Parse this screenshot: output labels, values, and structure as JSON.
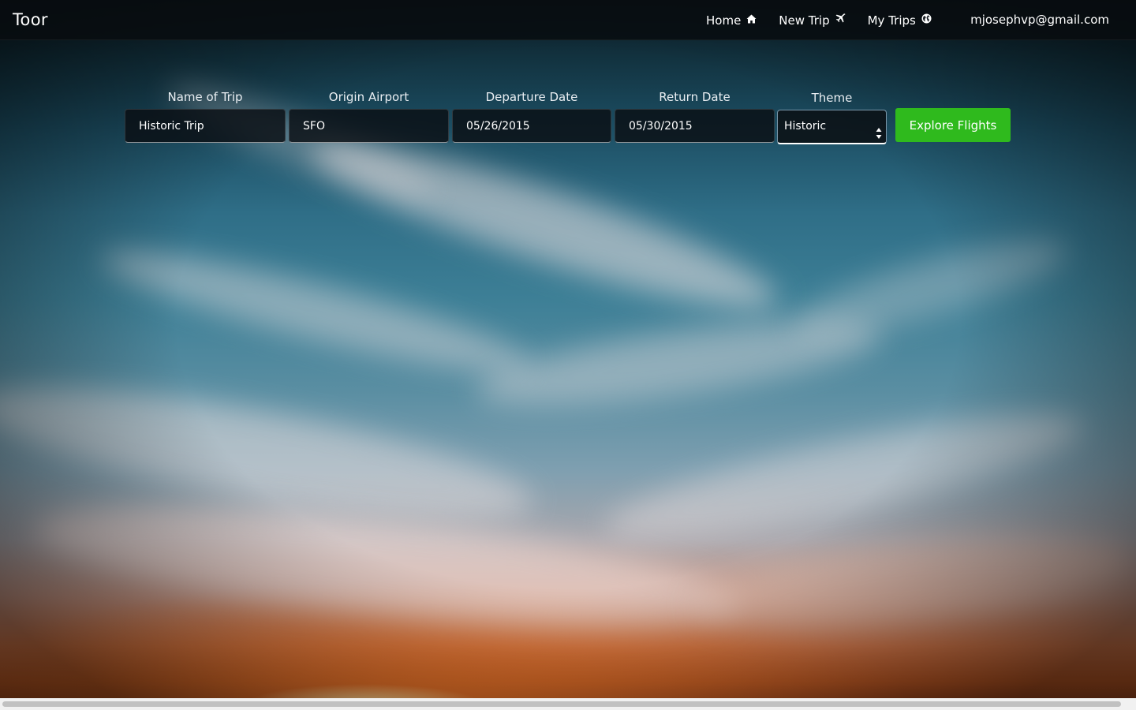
{
  "app": {
    "brand": "Toor"
  },
  "nav": {
    "items": [
      {
        "label": "Home",
        "icon": "home-icon"
      },
      {
        "label": "New Trip",
        "icon": "plane-icon"
      },
      {
        "label": "My Trips",
        "icon": "globe-icon"
      }
    ],
    "user_email": "mjosephvp@gmail.com"
  },
  "form": {
    "trip_name": {
      "label": "Name of Trip",
      "value": "Historic Trip"
    },
    "origin": {
      "label": "Origin Airport",
      "value": "SFO"
    },
    "departure": {
      "label": "Departure Date",
      "value": "05/26/2015"
    },
    "return_date": {
      "label": "Return Date",
      "value": "05/30/2015"
    },
    "theme": {
      "label": "Theme",
      "selected": "Historic"
    },
    "submit_label": "Explore Flights"
  },
  "colors": {
    "accent_button": "#2fba1d",
    "navbar": "#0a0e12",
    "text": "#ffffff"
  }
}
